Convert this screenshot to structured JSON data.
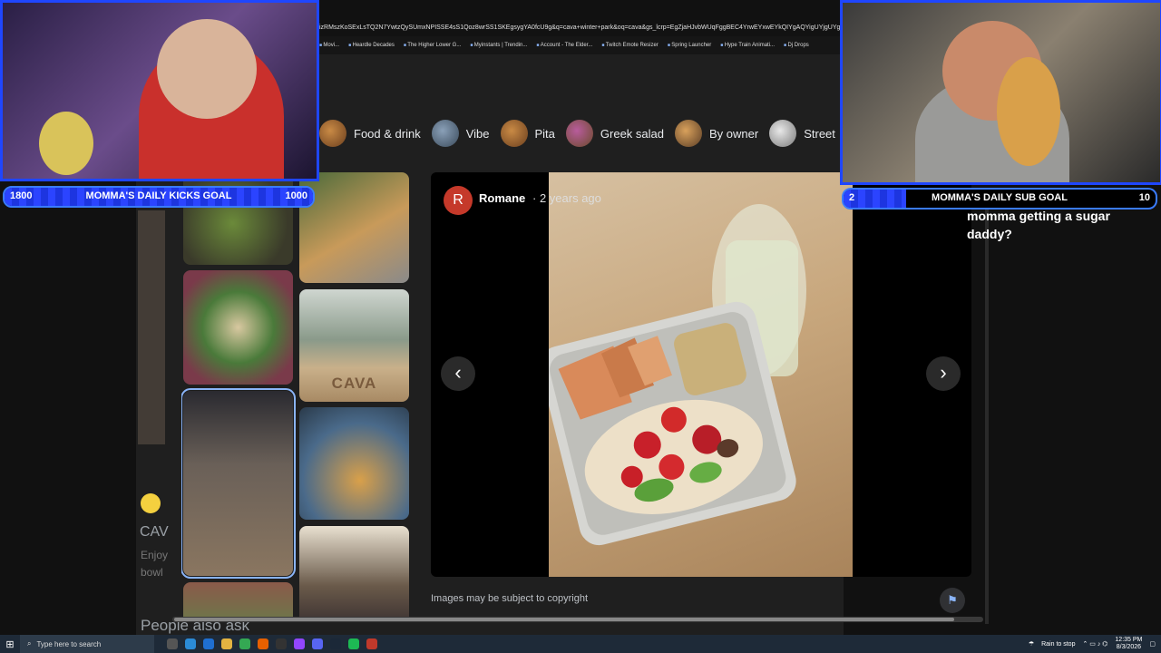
{
  "browser": {
    "url_fragment": "izRMszKoSExLsTQ2N7YwtzQySUmxNPISSE4sS1Qoz8wrSS1SKEgsygYA0fcU9g&q=cava+winter+park&oq=cava&gs_lcrp=EgZjaHJvbWUqFggBEC4YrwEYxwEYkQIYgAQYigUYjgUYgBygAEEUYO",
    "bookmarks": [
      "Movi...",
      "Heardle Decades",
      "The Higher Lower G...",
      "Myinstants | Trendin...",
      "Account - The Elder...",
      "Twitch Emote Resizer",
      "Spring Launcher",
      "Hype Train Animati...",
      "Dj Drops"
    ]
  },
  "chips": [
    {
      "label": "Food & drink",
      "icon": "food-thumb"
    },
    {
      "label": "Vibe",
      "icon": "vibe-thumb"
    },
    {
      "label": "Pita",
      "icon": "pita-thumb"
    },
    {
      "label": "Greek salad",
      "icon": "greek-salad-thumb"
    },
    {
      "label": "By owner",
      "icon": "owner-thumb"
    },
    {
      "label": "Street",
      "icon": "street-thumb"
    }
  ],
  "background_page": {
    "title": "CAV",
    "snippet_line1": "Enjoy",
    "snippet_line2": "bowl",
    "people_also_ask": "People also ask"
  },
  "thumbnails": {
    "cava_label": "CAVA"
  },
  "viewer": {
    "avatar_letter": "R",
    "author": "Romane",
    "age": "2 years ago",
    "prev_icon": "‹",
    "next_icon": "›",
    "copyright": "Images may be subject to copyright",
    "flag_icon": "flag-icon"
  },
  "overlay": {
    "kicks_goal": {
      "left": "1800",
      "label": "MOMMA'S DAILY KICKS GOAL",
      "right": "1000"
    },
    "sub_goal": {
      "left": "2",
      "label": "MOMMA'S DAILY SUB GOAL",
      "right": "10"
    },
    "chat_text": "momma getting a sugar daddy?"
  },
  "taskbar": {
    "search_placeholder": "Type here to search",
    "weather": "Rain to stop",
    "time": "12:35 PM",
    "date": "8/3/2026"
  }
}
